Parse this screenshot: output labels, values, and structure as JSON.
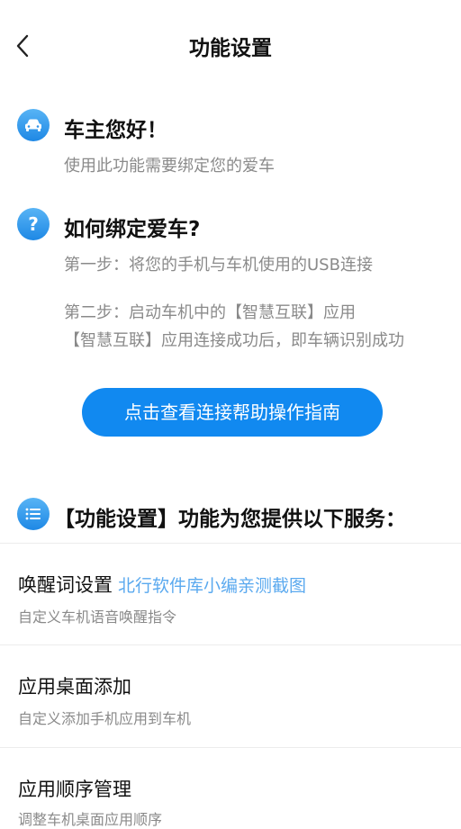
{
  "header": {
    "title": "功能设置",
    "back_icon": "chevron-left-icon"
  },
  "welcome": {
    "icon": "car-icon",
    "title": "车主您好！",
    "desc": "使用此功能需要绑定您的爱车"
  },
  "howto": {
    "icon": "question-icon",
    "title": "如何绑定爱车?",
    "step1": "第一步：将您的手机与车机使用的USB连接",
    "step2_line1": "第二步：启动车机中的【智慧互联】应用",
    "step2_line2": "【智慧互联】应用连接成功后，即车辆识别成功"
  },
  "cta": {
    "label": "点击查看连接帮助操作指南"
  },
  "services": {
    "icon": "list-icon",
    "title": "【功能设置】功能为您提供以下服务："
  },
  "items": [
    {
      "title": "唤醒词设置",
      "note": "北行软件库小编亲测截图",
      "sub": "自定义车机语音唤醒指令"
    },
    {
      "title": "应用桌面添加",
      "sub": "自定义添加手机应用到车机"
    },
    {
      "title": "应用顺序管理",
      "sub": "调整车机桌面应用顺序"
    }
  ],
  "colors": {
    "accent": "#1189f0",
    "icon_gradient_top": "#58b4f5",
    "icon_gradient_bottom": "#1e88e5",
    "muted_text": "#8a8a8a",
    "note_text": "#5aa9ef"
  }
}
